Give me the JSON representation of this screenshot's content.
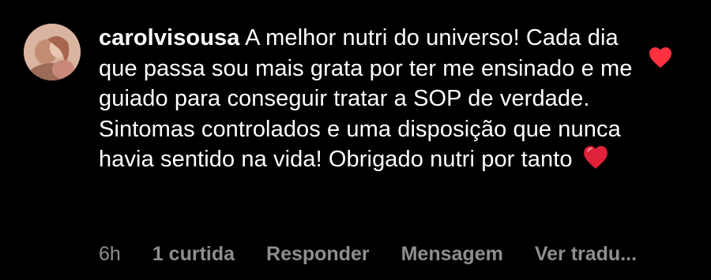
{
  "comment": {
    "username": "carolvisousa",
    "text": "A melhor nutri do universo! Cada dia que passa sou mais grata por ter me ensinado e me guiado para conseguir tratar a SOP de verdade. Sintomas controlados e uma disposição que nunca havia sentido na vida! Obrigado nutri por tanto",
    "emoji": "red-heart-emoji",
    "liked": true
  },
  "meta": {
    "time": "6h",
    "likes": "1 curtida",
    "reply_label": "Responder",
    "message_label": "Mensagem",
    "translate_label": "Ver tradu..."
  },
  "colors": {
    "background": "#000000",
    "text": "#ffffff",
    "secondary": "#8e8e8e",
    "like_heart": "#ff3040"
  },
  "icons": {
    "like": "heart-icon",
    "avatar": "avatar"
  }
}
